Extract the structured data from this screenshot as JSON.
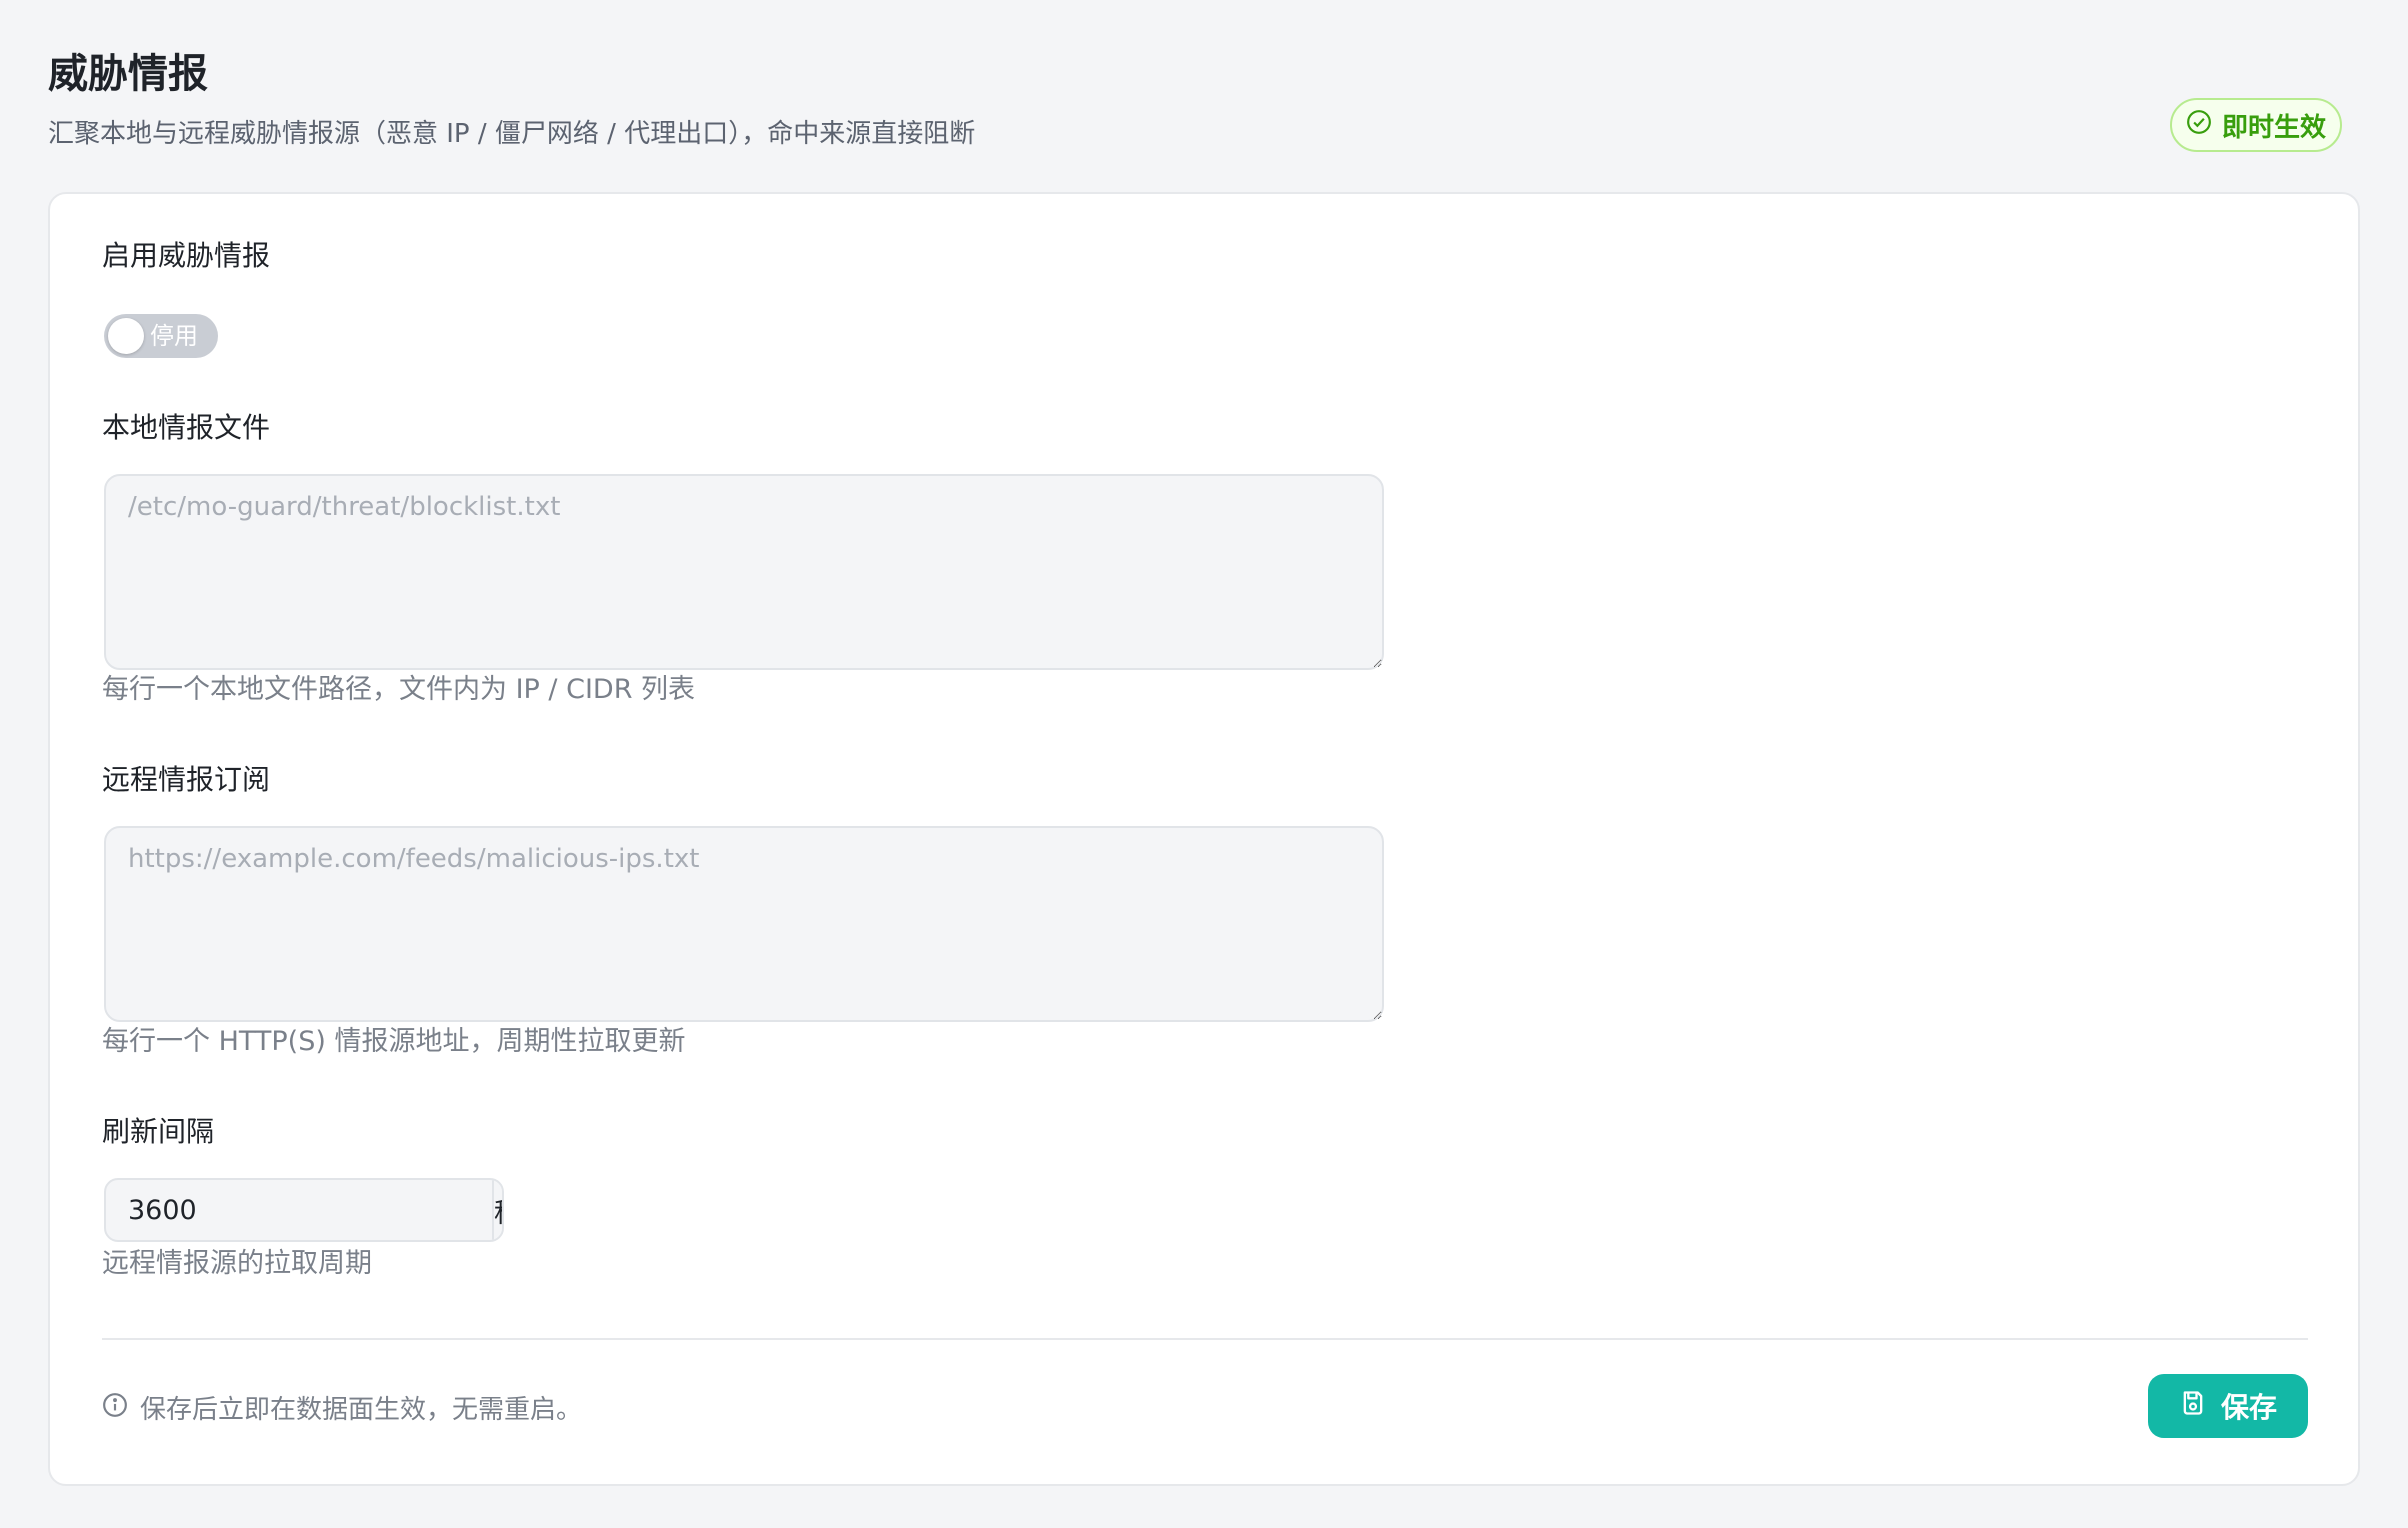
{
  "header": {
    "title": "威胁情报",
    "subtitle": "汇聚本地与远程威胁情报源（恶意 IP / 僵尸网络 / 代理出口），命中来源直接阻断",
    "badge": {
      "label": "即时生效",
      "icon": "check-circle-icon",
      "color": "#389e0d"
    }
  },
  "form": {
    "enable": {
      "label": "启用威胁情报",
      "toggle_text": "停用",
      "enabled": false
    },
    "local_files": {
      "label": "本地情报文件",
      "value": "",
      "placeholder": "/etc/mo-guard/threat/blocklist.txt",
      "help": "每行一个本地文件路径，文件内为 IP / CIDR 列表"
    },
    "remote_feeds": {
      "label": "远程情报订阅",
      "value": "",
      "placeholder": "https://example.com/feeds/malicious-ips.txt",
      "help": "每行一个 HTTP(S) 情报源地址，周期性拉取更新"
    },
    "refresh_interval": {
      "label": "刷新间隔",
      "value": "3600",
      "unit": "秒",
      "help": "远程情报源的拉取周期"
    }
  },
  "footer": {
    "note": "保存后立即在数据面生效，无需重启。",
    "note_icon": "info-circle-icon",
    "save_label": "保存",
    "save_icon": "save-icon",
    "accent": "#13b8a6"
  }
}
